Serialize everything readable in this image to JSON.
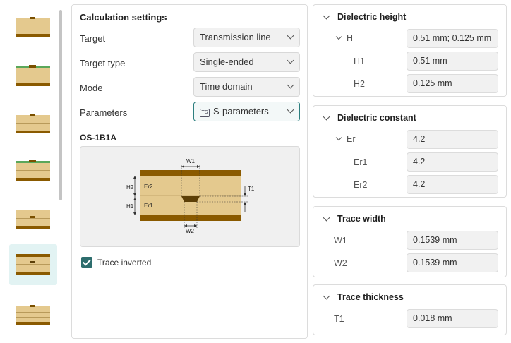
{
  "calculation": {
    "title": "Calculation settings",
    "rows": [
      {
        "label": "Target",
        "value": "Transmission line"
      },
      {
        "label": "Target type",
        "value": "Single-ended"
      },
      {
        "label": "Mode",
        "value": "Time domain"
      },
      {
        "label": "Parameters",
        "value": "S-parameters",
        "badge": "TS"
      }
    ],
    "structure_name": "OS-1B1A",
    "trace_inverted": {
      "label": "Trace inverted",
      "checked": true
    }
  },
  "diagram": {
    "labels": {
      "W1": "W1",
      "W2": "W2",
      "H2": "H2",
      "H1": "H1",
      "Er2": "Er2",
      "Er1": "Er1",
      "T1": "T1"
    },
    "colors": {
      "copper": "#8a5a00",
      "dielectric": "#e4c98e",
      "trace": "#5c3f07"
    }
  },
  "thumbnails": {
    "count": 7,
    "selected_index": 5
  },
  "dielectric_height": {
    "title": "Dielectric height",
    "group": {
      "label": "H",
      "value": "0.51 mm; 0.125 mm"
    },
    "items": [
      {
        "label": "H1",
        "value": "0.51 mm"
      },
      {
        "label": "H2",
        "value": "0.125 mm"
      }
    ]
  },
  "dielectric_constant": {
    "title": "Dielectric constant",
    "group": {
      "label": "Er",
      "value": "4.2"
    },
    "items": [
      {
        "label": "Er1",
        "value": "4.2"
      },
      {
        "label": "Er2",
        "value": "4.2"
      }
    ]
  },
  "trace_width": {
    "title": "Trace width",
    "items": [
      {
        "label": "W1",
        "value": "0.1539 mm"
      },
      {
        "label": "W2",
        "value": "0.1539 mm"
      }
    ]
  },
  "trace_thickness": {
    "title": "Trace thickness",
    "items": [
      {
        "label": "T1",
        "value": "0.018 mm"
      }
    ]
  }
}
